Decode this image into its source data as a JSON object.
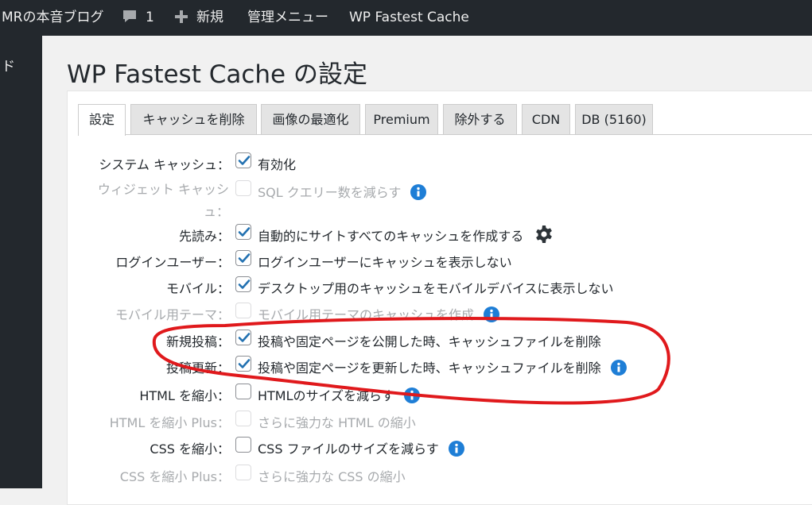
{
  "adminbar": {
    "site_name": "MRの本音ブログ",
    "comment_count": "1",
    "new_label": "新規",
    "admin_menu_label": "管理メニュー",
    "plugin_label": "WP Fastest Cache"
  },
  "sidebar": {
    "visible_fragment": "ド"
  },
  "page": {
    "title": "WP Fastest Cache の設定"
  },
  "tabs": [
    {
      "label": "設定",
      "active": true
    },
    {
      "label": "キャッシュを削除"
    },
    {
      "label": "画像の最適化"
    },
    {
      "label": "Premium"
    },
    {
      "label": "除外する"
    },
    {
      "label": "CDN"
    },
    {
      "label": "DB (5160)"
    }
  ],
  "settings": [
    {
      "label": "システム キャッシュ：",
      "checked": true,
      "disabled": false,
      "description": "有効化"
    },
    {
      "label_line1": "ウィジェット キャッシ",
      "label_line2": "ュ：",
      "checked": false,
      "disabled": true,
      "description": "SQL クエリー数を減らす",
      "icon": "info-icon"
    },
    {
      "label": "先読み：",
      "checked": true,
      "disabled": false,
      "description": "自動的にサイトすべてのキャッシュを作成する",
      "icon": "gear-icon"
    },
    {
      "label": "ログインユーザー：",
      "checked": true,
      "disabled": false,
      "description": "ログインユーザーにキャッシュを表示しない"
    },
    {
      "label": "モバイル：",
      "checked": true,
      "disabled": false,
      "description": "デスクトップ用のキャッシュをモバイルデバイスに表示しない"
    },
    {
      "label": "モバイル用テーマ：",
      "checked": false,
      "disabled": true,
      "description": "モバイル用テーマのキャッシュを作成",
      "icon": "info-icon"
    },
    {
      "label": "新規投稿：",
      "checked": true,
      "disabled": false,
      "description": "投稿や固定ページを公開した時、キャッシュファイルを削除"
    },
    {
      "label": "投稿更新：",
      "checked": true,
      "disabled": false,
      "description": "投稿や固定ページを更新した時、キャッシュファイルを削除",
      "icon": "info-icon"
    },
    {
      "label": "HTML を縮小：",
      "checked": false,
      "disabled": false,
      "description": "HTMLのサイズを減らす",
      "icon": "info-icon"
    },
    {
      "label": "HTML を縮小 Plus：",
      "checked": false,
      "disabled": true,
      "description": "さらに強力な HTML の縮小"
    },
    {
      "label": "CSS を縮小：",
      "checked": false,
      "disabled": false,
      "description": "CSS ファイルのサイズを減らす",
      "icon": "info-icon"
    },
    {
      "label": "CSS を縮小 Plus：",
      "checked": false,
      "disabled": true,
      "description": "さらに強力な CSS の縮小"
    }
  ],
  "colors": {
    "accent": "#2271b1",
    "info": "#1e7ed6",
    "annotation": "#e0191c",
    "adminbar": "#23282d"
  }
}
